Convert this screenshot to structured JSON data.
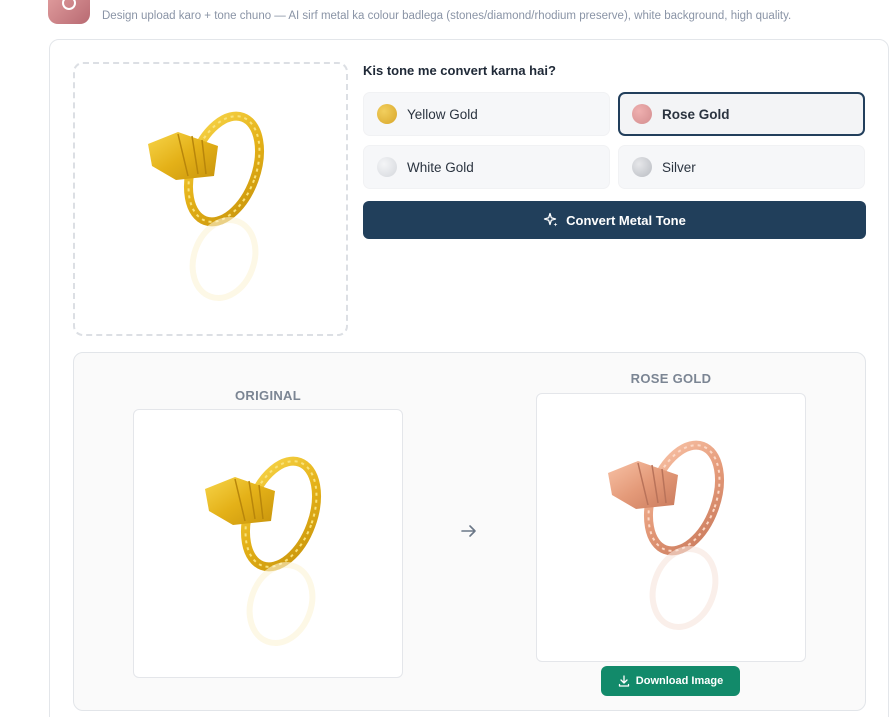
{
  "header": {
    "subtitle": "Design upload karo + tone chuno — AI sirf metal ka colour badlega (stones/diamond/rhodium preserve), white background, high quality."
  },
  "tone_selector": {
    "title": "Kis tone me convert karna hai?",
    "options": [
      {
        "label": "Yellow Gold",
        "swatch": "#e2b73d",
        "selected": false
      },
      {
        "label": "Rose Gold",
        "swatch": "#dd9c9e",
        "selected": true
      },
      {
        "label": "White Gold",
        "swatch": "#e6e8eb",
        "selected": false
      },
      {
        "label": "Silver",
        "swatch": "#cfd1d5",
        "selected": false
      }
    ],
    "convert_label": "Convert Metal Tone"
  },
  "comparison": {
    "original_label": "ORIGINAL",
    "converted_label": "ROSE GOLD",
    "download_label": "Download Image"
  },
  "colors": {
    "primary": "#213f5b",
    "download": "#128a6a",
    "yellow_gold": "#e2b21e",
    "rose_gold": "#e9a083"
  }
}
